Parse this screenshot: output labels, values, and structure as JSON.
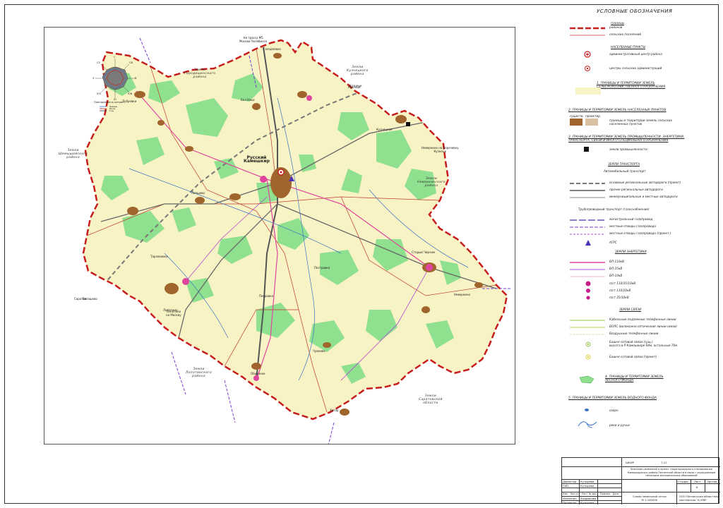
{
  "legend": {
    "title": "УСЛОВНЫЕ ОБОЗНАЧЕНИЯ",
    "borders_title": "границы",
    "border_district": "районов",
    "border_rural": "сельских поселений",
    "settlements_title": "НАСЕЛЕННЫЕ ПУНКТЫ",
    "admin_center": "административный центр района",
    "rural_admin_center": "центры сельских администраций",
    "sec1": "1. ГРАНИЦЫ И ТЕРРИТОРИИ ЗЕМЕЛЬ\nСЕЛЬСКОХОЗЯЙСТВЕННОГО НАЗНАЧЕНИЯ",
    "sec2": "2. ГРАНИЦЫ И ТЕРРИТОРИИ ЗЕМЕЛЬ НАСЕЛЕННЫХ ПУНКТОВ",
    "exist": "существ.",
    "proj": "проектир.",
    "sec2_item": "границы и территории земель сельских\nнаселенных пунктов",
    "sec3": "3. ГРАНИЦЫ И ТЕРРИТОРИИ ЗЕМЕЛЬ ПРОМЫШЛЕННОСТИ, ЭНЕРГЕТИКИ,\nТРАНСПОРТА, СВЯЗИ И ИНОГО СПЕЦИАЛЬНОГО НАЗНАЧЕНИЯ",
    "industry": "земли промышленности",
    "transport_title": "ЗЕМЛИ ТРАНСПОРТА",
    "auto_title": "Автомобильный транспорт",
    "road_main": "основные региональные автодороги (проект)",
    "road_other": "прочие региональные автодороги",
    "road_local": "межмуниципальные и местные автодороги",
    "pipe_title": "Трубопроводный транспорт (газоснабжение)",
    "gas_main": "магистральный газопровод",
    "gas_branch": "местные отводы газопровода",
    "gas_branch_proj": "местные отводы газопровода (проект.)",
    "agrs": "АГРС",
    "energy_title": "ЗЕМЛИ ЭНЕРГЕТИКИ",
    "vl110": "ВЛ-110кВ",
    "vl35": "ВЛ-35кВ",
    "vl10": "ВЛ-10кВ",
    "ps1": "п/ст 110/35/10кВ",
    "ps2": "п/ст 110/10кВ",
    "ps3": "п/ст 35/10кВ",
    "comm_title": "ЗЕМЛИ СВЯЗИ",
    "cable": "Кабельные подземные телефонные линии",
    "fiber": "ВОЛС (волоконно-оптические линии связи)",
    "air": "Воздушные телефонные линии",
    "tower": "Башня сотовой связи (сущ.)\nвысота в Р.Камешкире 64м, остальные-70м",
    "tower_proj": "Башня сотовой связи (проект)",
    "sec4": "4. ГРАНИЦЫ И ТЕРРИТОРИИ ЗЕМЕЛЬ\nЛЕСНОГО ФОНДА",
    "sec5": "5. ГРАНИЦЫ И ТЕРРИТОРИИ ЗЕМЕЛЬ ВОДНОГО ФОНДА",
    "lake": "озеро",
    "rivers": "реки и ручьи"
  },
  "compass": {
    "n": "С",
    "s": "Ю",
    "e": "В",
    "w": "З",
    "ne": "СВ",
    "nw": "СЗ",
    "se": "ЮВ",
    "sw": "ЮЗ",
    "title": "Повторяемость ветра",
    "l1": "Январь",
    "l2": "Июль",
    "l3": "Год"
  },
  "map": {
    "lands": [
      {
        "text": "Земли\nГородищенского\nрайона"
      },
      {
        "text": "Земли\nКузнецкого\nрайона"
      },
      {
        "text": "Земли\nШемышейского\nрайона"
      },
      {
        "text": "Земли\nНеверкинского\nрайона"
      },
      {
        "text": "Земли\nЛопатинского\nрайона"
      },
      {
        "text": "Земли\nСаратовской\nобласти"
      }
    ],
    "center": "Русский\nКамешкир",
    "towns": [
      "Лапшово",
      "Пестровка",
      "Старый Чирчим",
      "Кузнецк",
      "Бол.Умыс",
      "Дубровки",
      "Покровка",
      "Оброчное",
      "Чумаево",
      "Лопатино",
      "Евлашево",
      "Голодяевка",
      "Тарлаковка",
      "Кузнецкое",
      "Неверкино",
      "Хутор"
    ],
    "signs": {
      "highway": "На трассу М5\nМосква-Челябинск",
      "kuzn": "Кузнецк",
      "nev": "Неверкино на Березовку\nКузнецк",
      "lop": "Лопатино\nна Москву",
      "sar": "Саратов"
    }
  },
  "title_block": {
    "code": "ШКИР",
    "code2": "7-11",
    "project": "Внесение изменений в проект территориального планирования\nКамешкирского района Пензенской области в связи с упразднением\nнекоторых муниципальных образований",
    "stage_h": "Стадия",
    "sheet_h": "Лист",
    "sheets_h": "Листов",
    "sheet": "6",
    "name": "Схема земельной сетки\nМ 1:100000",
    "org": "ООО Пензенская областная\nмастерская \"А-998\"",
    "head": [
      "Изм.",
      "Кол.уч",
      "Лист",
      "№ док.",
      "Подпись",
      "Дата"
    ],
    "rows": [
      [
        "Директор",
        "Кутырева"
      ],
      [
        "ГИП",
        "Кутырева"
      ],
      [
        "Исполнил",
        "Андрюкова"
      ],
      [
        "Проверил",
        "Кутырева"
      ]
    ]
  }
}
